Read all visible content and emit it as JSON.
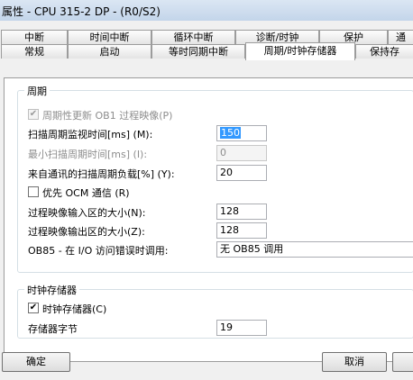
{
  "window": {
    "title": "属性 - CPU 315-2 DP - (R0/S2)"
  },
  "tabs": {
    "row1": [
      "中断",
      "时间中断",
      "循环中断",
      "诊断/时钟",
      "保护",
      "通"
    ],
    "row2": [
      "常规",
      "启动",
      "等时同期中断",
      "周期/时钟存储器",
      "保持存"
    ]
  },
  "cycle": {
    "group_title": "周期",
    "periodic_update_label": "周期性更新 OB1 过程映像(P)",
    "periodic_update_checked": true,
    "periodic_update_disabled": true,
    "scan_monitor_label": "扫描周期监视时间[ms] (M):",
    "scan_monitor_value": "150",
    "min_scan_label": "最小扫描周期时间[ms] (I):",
    "min_scan_value": "0",
    "comm_load_label": "来自通讯的扫描周期负载[%] (Y):",
    "comm_load_value": "20",
    "priority_ocm_label": "优先 OCM 通信 (R)",
    "priority_ocm_checked": false,
    "input_image_label": "过程映像输入区的大小(N):",
    "input_image_value": "128",
    "output_image_label": "过程映像输出区的大小(Z):",
    "output_image_value": "128",
    "ob85_label": "OB85 - 在 I/O 访问错误时调用:",
    "ob85_value": "无 OB85 调用"
  },
  "clock_memory": {
    "group_title": "时钟存储器",
    "enable_label": "时钟存储器(C)",
    "enable_checked": true,
    "byte_label": "存储器字节",
    "byte_value": "19"
  },
  "buttons": {
    "ok": "确定",
    "cancel": "取消"
  },
  "glyphs": {
    "check": "✔"
  }
}
